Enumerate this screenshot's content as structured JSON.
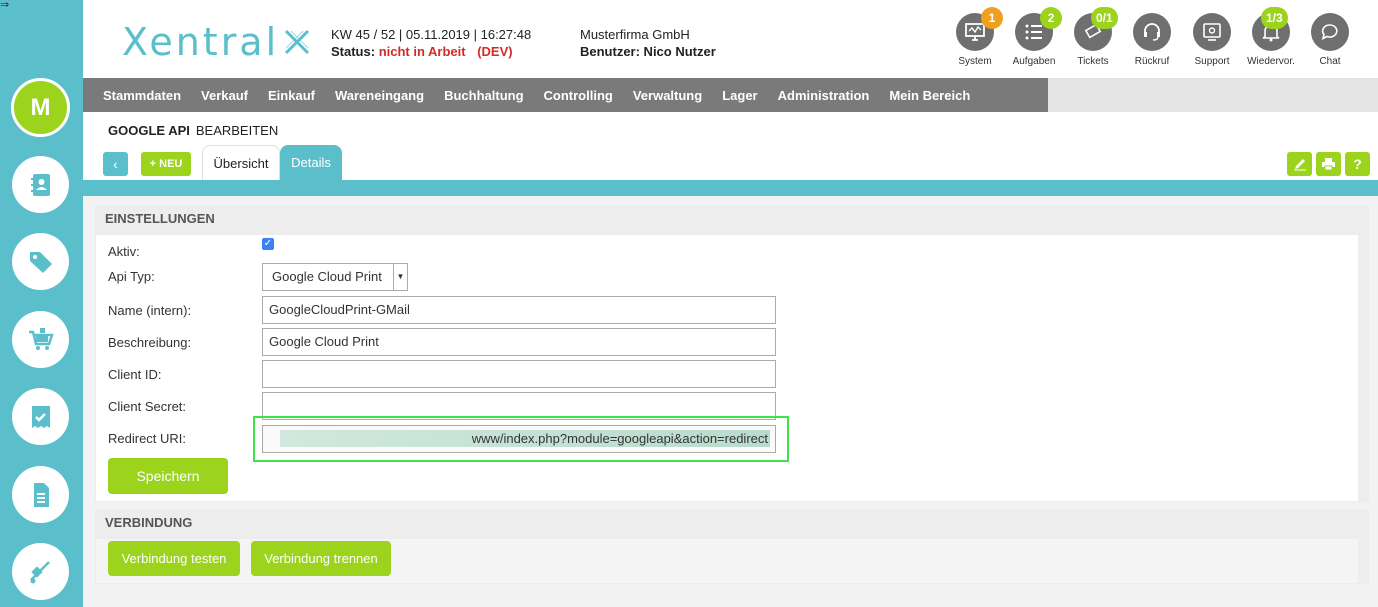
{
  "colors": {
    "teal": "#5bbfcb",
    "green": "#9bd31d",
    "orange": "#f0a020",
    "nav": "#7a7a7a",
    "highlight": "#3ce34a"
  },
  "sidebar": {
    "avatar_letter": "M",
    "items": [
      {
        "icon": "contacts-icon"
      },
      {
        "icon": "tags-icon"
      },
      {
        "icon": "cart-icon"
      },
      {
        "icon": "ticket-check-icon"
      },
      {
        "icon": "document-icon"
      },
      {
        "icon": "hand-truck-icon"
      }
    ]
  },
  "header": {
    "logo": "Xentral",
    "week": "KW 45 / 52 | 05.11.2019 | 16:27:48",
    "status_label": "Status:",
    "status_value": "nicht in Arbeit",
    "env": "(DEV)",
    "company": "Musterfirma GmbH",
    "user": "Benutzer: Nico Nutzer"
  },
  "quick_actions": [
    {
      "label": "System",
      "badge": "1",
      "icon": "monitor-icon"
    },
    {
      "label": "Aufgaben",
      "badge": "2",
      "icon": "list-icon"
    },
    {
      "label": "Tickets",
      "badge": "0/1",
      "icon": "ticket-icon"
    },
    {
      "label": "Rückruf",
      "badge": "",
      "icon": "headset-icon"
    },
    {
      "label": "Support",
      "badge": "",
      "icon": "support-icon"
    },
    {
      "label": "Wiedervor.",
      "badge": "1/3",
      "icon": "bell-icon"
    },
    {
      "label": "Chat",
      "badge": "",
      "icon": "chat-icon"
    }
  ],
  "nav": [
    "Stammdaten",
    "Verkauf",
    "Einkauf",
    "Wareneingang",
    "Buchhaltung",
    "Controlling",
    "Verwaltung",
    "Lager",
    "Administration",
    "Mein Bereich"
  ],
  "page": {
    "title": "GOOGLE API",
    "subtitle": "BEARBEITEN",
    "new_label": "+ NEU",
    "tabs": [
      "Übersicht",
      "Details"
    ]
  },
  "settings": {
    "title": "EINSTELLUNGEN",
    "aktiv_label": "Aktiv:",
    "api_typ_label": "Api Typ:",
    "api_typ_value": "Google Cloud Print",
    "name_label": "Name (intern):",
    "name_value": "GoogleCloudPrint-GMail",
    "beschreibung_label": "Beschreibung:",
    "beschreibung_value": "Google Cloud Print",
    "client_id_label": "Client ID:",
    "client_id_value": "",
    "client_secret_label": "Client Secret:",
    "client_secret_value": "",
    "redirect_label": "Redirect URI:",
    "redirect_value": "www/index.php?module=googleapi&action=redirect",
    "save_label": "Speichern"
  },
  "connection": {
    "title": "VERBINDUNG",
    "test_label": "Verbindung testen",
    "disconnect_label": "Verbindung trennen"
  }
}
